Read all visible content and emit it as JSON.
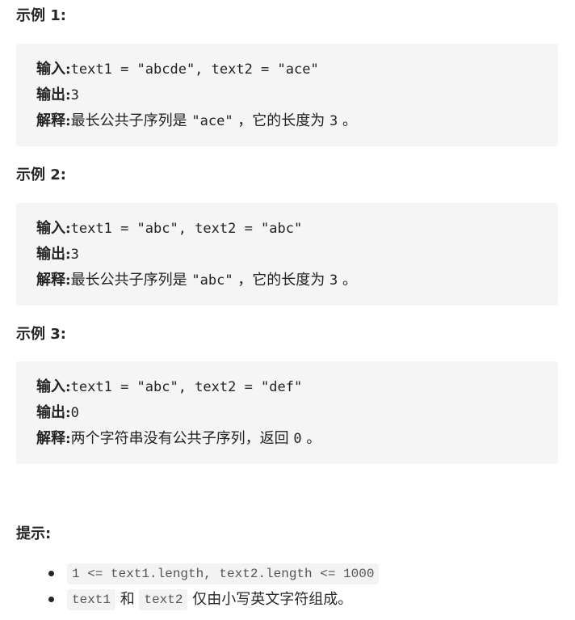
{
  "examples": [
    {
      "title": "示例 1:",
      "input_label": "输入:",
      "input_value": "text1 = \"abcde\", text2 = \"ace\"",
      "output_label": "输出:",
      "output_value": "3",
      "explain_label": "解释:",
      "explain_pre": "最长公共子序列是 ",
      "explain_code": "\"ace\"",
      "explain_mid": " ，它的长度为 ",
      "explain_num": "3",
      "explain_post": " 。"
    },
    {
      "title": "示例 2:",
      "input_label": "输入:",
      "input_value": "text1 = \"abc\", text2 = \"abc\"",
      "output_label": "输出:",
      "output_value": "3",
      "explain_label": "解释:",
      "explain_pre": "最长公共子序列是 ",
      "explain_code": "\"abc\"",
      "explain_mid": " ，它的长度为 ",
      "explain_num": "3",
      "explain_post": " 。"
    },
    {
      "title": "示例 3:",
      "input_label": "输入:",
      "input_value": "text1 = \"abc\", text2 = \"def\"",
      "output_label": "输出:",
      "output_value": "0",
      "explain_label": "解释:",
      "explain_pre": "两个字符串没有公共子序列，返回 ",
      "explain_num": "0",
      "explain_post": " 。"
    }
  ],
  "hints": {
    "title": "提示:",
    "item1_code": "1 <= text1.length, text2.length <= 1000",
    "item2_code1": "text1",
    "item2_text1": " 和 ",
    "item2_code2": "text2",
    "item2_text2": " 仅由小写英文字符组成。"
  }
}
